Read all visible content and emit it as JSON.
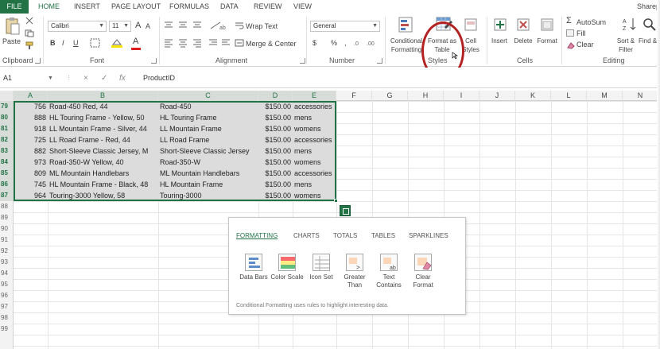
{
  "ribbon_tabs": [
    "FILE",
    "HOME",
    "INSERT",
    "PAGE LAYOUT",
    "FORMULAS",
    "DATA",
    "REVIEW",
    "VIEW"
  ],
  "account": "Sharep",
  "clipboard": {
    "paste": "Paste",
    "label": "Clipboard"
  },
  "font": {
    "name": "Calibri",
    "size": "11",
    "bold": "B",
    "italic": "I",
    "underline": "U",
    "grow": "A",
    "shrink": "A",
    "font_color": "A",
    "label": "Font"
  },
  "alignment": {
    "wrap": "Wrap Text",
    "merge": "Merge & Center",
    "label": "Alignment"
  },
  "number": {
    "format": "General",
    "currency": "$",
    "percent": "%",
    "comma": ",",
    "label": "Number"
  },
  "styles": {
    "conditional": "Conditional Formatting",
    "format_table": "Format as Table",
    "cell_styles": "Cell Styles",
    "label": "Styles"
  },
  "cells": {
    "insert": "Insert",
    "delete": "Delete",
    "format": "Format",
    "label": "Cells"
  },
  "editing": {
    "autosum": "AutoSum",
    "fill": "Fill",
    "clear": "Clear",
    "sort": "Sort & Filter",
    "find": "Find & Select",
    "label": "Editing"
  },
  "formula_bar": {
    "name_box": "A1",
    "cancel": "×",
    "enter": "✓",
    "fx": "fx",
    "value": "ProductID"
  },
  "columns": [
    "A",
    "B",
    "C",
    "D",
    "E",
    "F",
    "G",
    "H",
    "I",
    "J",
    "K",
    "L",
    "M",
    "N"
  ],
  "rows": [
    {
      "num": "79",
      "a": "756",
      "b": "Road-450 Red, 44",
      "c": "Road-450",
      "d": "$150.00",
      "e": "accessories"
    },
    {
      "num": "80",
      "a": "888",
      "b": "HL Touring Frame - Yellow, 50",
      "c": "HL Touring Frame",
      "d": "$150.00",
      "e": "mens"
    },
    {
      "num": "81",
      "a": "918",
      "b": "LL Mountain Frame - Silver, 44",
      "c": "LL Mountain Frame",
      "d": "$150.00",
      "e": "womens"
    },
    {
      "num": "82",
      "a": "725",
      "b": "LL Road Frame - Red, 44",
      "c": "LL Road Frame",
      "d": "$150.00",
      "e": "accessories"
    },
    {
      "num": "83",
      "a": "882",
      "b": "Short-Sleeve Classic Jersey, M",
      "c": "Short-Sleeve Classic Jersey",
      "d": "$150.00",
      "e": "mens"
    },
    {
      "num": "84",
      "a": "973",
      "b": "Road-350-W Yellow, 40",
      "c": "Road-350-W",
      "d": "$150.00",
      "e": "womens"
    },
    {
      "num": "85",
      "a": "809",
      "b": "ML Mountain Handlebars",
      "c": "ML Mountain Handlebars",
      "d": "$150.00",
      "e": "accessories"
    },
    {
      "num": "86",
      "a": "745",
      "b": "HL Mountain Frame - Black, 48",
      "c": "HL Mountain Frame",
      "d": "$150.00",
      "e": "mens"
    },
    {
      "num": "87",
      "a": "964",
      "b": "Touring-3000 Yellow, 58",
      "c": "Touring-3000",
      "d": "$150.00",
      "e": "womens"
    }
  ],
  "empty_rows": [
    "88",
    "89",
    "90",
    "91",
    "92",
    "93",
    "94",
    "95",
    "96",
    "97",
    "98",
    "99"
  ],
  "quick_analysis": {
    "tabs": [
      "FORMATTING",
      "CHARTS",
      "TOTALS",
      "TABLES",
      "SPARKLINES"
    ],
    "items": [
      {
        "label": "Data Bars",
        "icon": "data-bars-icon"
      },
      {
        "label": "Color Scale",
        "icon": "color-scale-icon"
      },
      {
        "label": "Icon Set",
        "icon": "icon-set-icon"
      },
      {
        "label": "Greater Than",
        "icon": "greater-than-icon"
      },
      {
        "label": "Text Contains",
        "icon": "text-contains-icon"
      },
      {
        "label": "Clear Format",
        "icon": "clear-format-icon"
      }
    ],
    "description": "Conditional Formatting uses rules to highlight interesting data."
  },
  "colors": {
    "accent": "#217346",
    "highlight_circle": "#b22222",
    "selection_fill": "#dcdcdc"
  }
}
